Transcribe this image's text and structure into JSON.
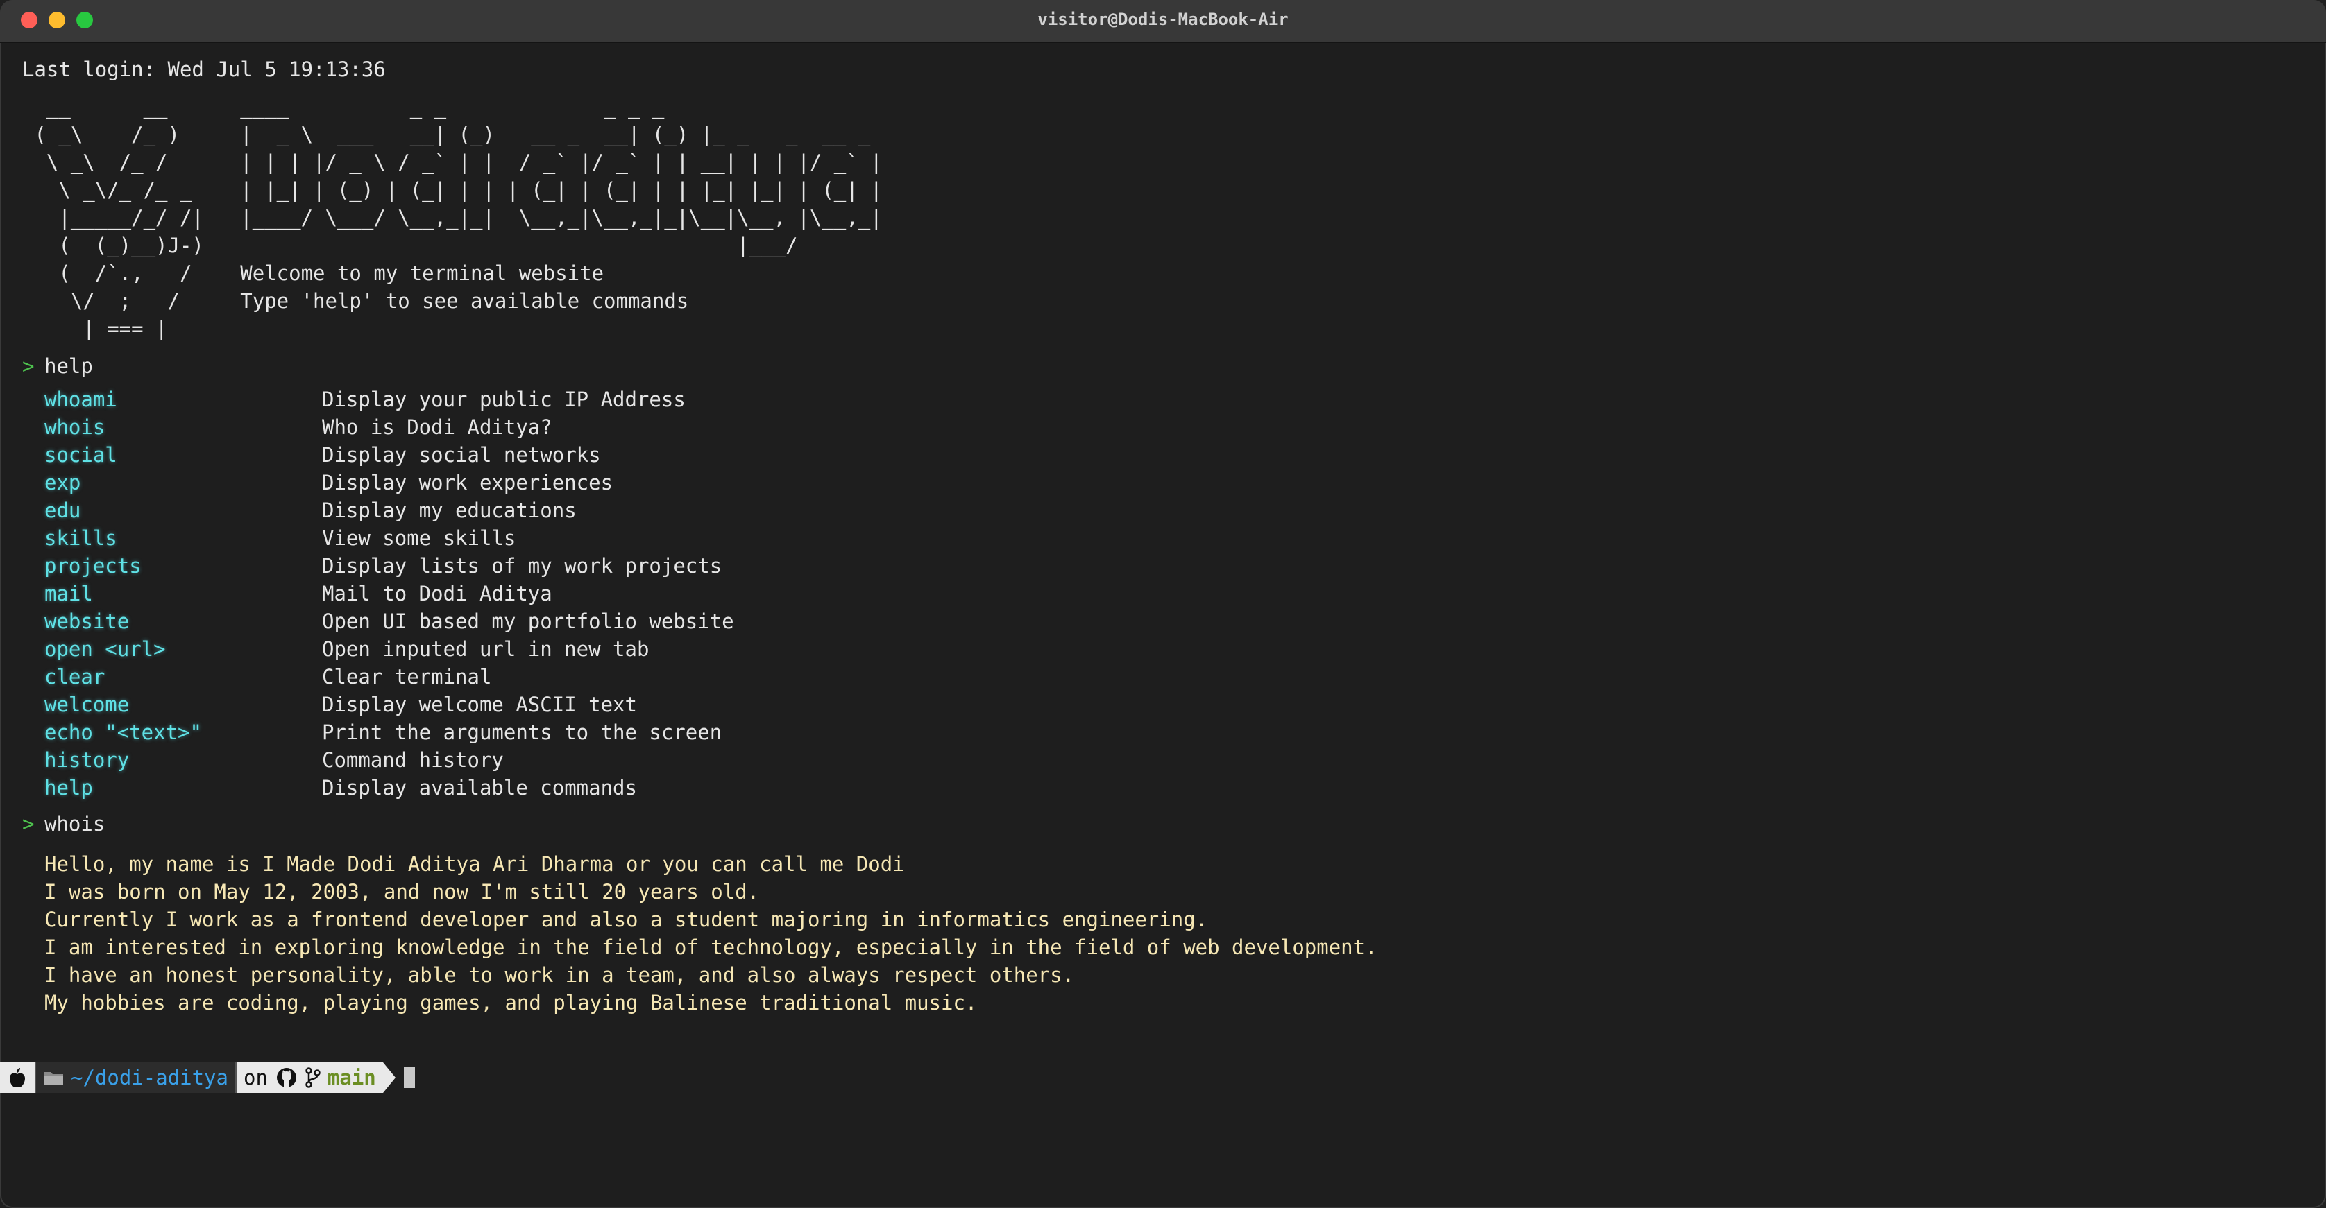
{
  "window": {
    "title": "visitor@Dodis-MacBook-Air"
  },
  "terminal": {
    "last_login": "Last login: Wed Jul 5 19:13:36",
    "ascii_art": "  __      __      ____          _ _             _ _ _\n ( _\\    /_ )     |  _ \\  ___   __| (_)   __ _  __| (_) |_ _   _  __ _\n  \\ _\\  /_ /      | | | |/ _ \\ / _` | |  / _` |/ _` | | __| | | |/ _` |\n   \\ _\\/_ /_ _    | |_| | (_) | (_| | | | (_| | (_| | | |_| |_| | (_| |\n   |_____/_/ /|   |____/ \\___/ \\__,_|_|  \\__,_|\\__,_|_|\\__|\\__, |\\__,_|\n   (  (_)__)J-)                                            |___/\n   (  /`.,   /    Welcome to my terminal website\n    \\/  ;   /     Type 'help' to see available commands\n     | === |",
    "prompt_symbol": ">",
    "command_1": "help",
    "help_commands": [
      {
        "name": "whoami",
        "desc": "Display your public IP Address"
      },
      {
        "name": "whois",
        "desc": "Who is Dodi Aditya?"
      },
      {
        "name": "social",
        "desc": "Display social networks"
      },
      {
        "name": "exp",
        "desc": "Display work experiences"
      },
      {
        "name": "edu",
        "desc": "Display my educations"
      },
      {
        "name": "skills",
        "desc": "View some skills"
      },
      {
        "name": "projects",
        "desc": "Display lists of my work projects"
      },
      {
        "name": "mail",
        "desc": "Mail to Dodi Aditya"
      },
      {
        "name": "website",
        "desc": "Open UI based my portfolio website"
      },
      {
        "name": "open <url>",
        "desc": "Open inputed url in new tab"
      },
      {
        "name": "clear",
        "desc": "Clear terminal"
      },
      {
        "name": "welcome",
        "desc": "Display welcome ASCII text"
      },
      {
        "name": "echo \"<text>\"",
        "desc": "Print the arguments to the screen"
      },
      {
        "name": "history",
        "desc": "Command history"
      },
      {
        "name": "help",
        "desc": "Display available commands"
      }
    ],
    "command_2": "whois",
    "whois_lines": [
      "Hello, my name is I Made Dodi Aditya Ari Dharma or you can call me Dodi",
      "I was born on May 12, 2003, and now I'm still 20 years old.",
      "Currently I work as a frontend developer and also a student majoring in informatics engineering.",
      "I am interested in exploring knowledge in the field of technology, especially in the field of web development.",
      "I have an honest personality, able to work in a team, and also always respect others.",
      "My hobbies are coding, playing games, and playing Balinese traditional music."
    ]
  },
  "statusbar": {
    "apple_icon": "apple-icon",
    "folder_icon": "folder-icon",
    "directory": "~/dodi-aditya",
    "on_label": "on",
    "github_icon": "github-icon",
    "branch_icon": "git-branch-icon",
    "branch": "main"
  }
}
